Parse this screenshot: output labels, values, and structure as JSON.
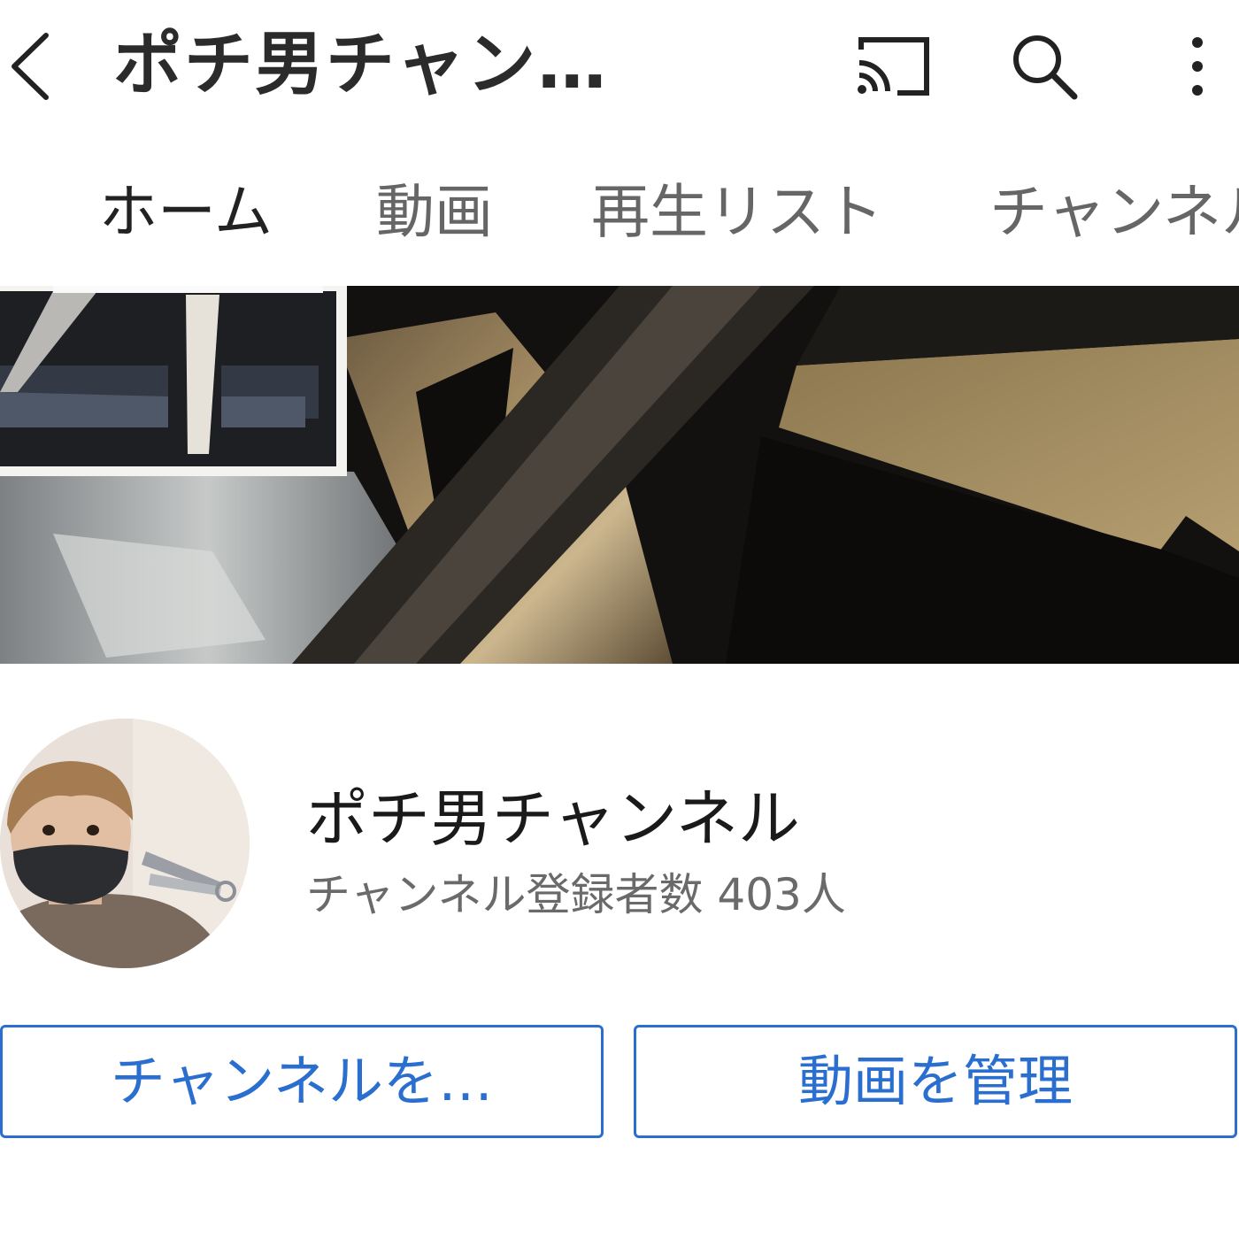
{
  "header": {
    "back_icon": "chevron-left-icon",
    "title": "ポチ男チャン…",
    "cast_icon": "cast-icon",
    "search_icon": "search-icon",
    "more_icon": "more-vertical-icon"
  },
  "tabs": [
    {
      "label": "ホーム",
      "selected": true
    },
    {
      "label": "動画",
      "selected": false
    },
    {
      "label": "再生リスト",
      "selected": false
    },
    {
      "label": "チャンネル",
      "selected": false
    }
  ],
  "channel": {
    "name": "ポチ男チャンネル",
    "subscribers": "チャンネル登録者数 403人"
  },
  "actions": {
    "customize_label": "チャンネルを…",
    "manage_label": "動画を管理"
  },
  "colors": {
    "accent": "#2a6fd0",
    "title": "#2b2b2b",
    "tab_inactive": "#666666"
  }
}
